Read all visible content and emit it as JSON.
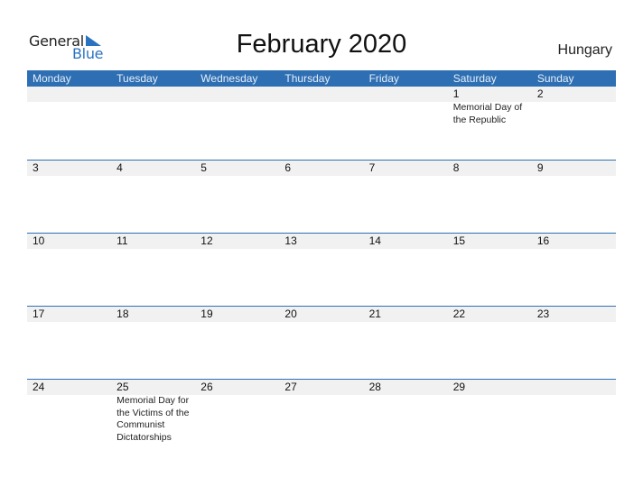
{
  "logo": {
    "general": "General",
    "blue": "Blue"
  },
  "title": "February 2020",
  "country": "Hungary",
  "colors": {
    "accent": "#2e6fb3",
    "strip": "#f1f1f1"
  },
  "weekdays": [
    "Monday",
    "Tuesday",
    "Wednesday",
    "Thursday",
    "Friday",
    "Saturday",
    "Sunday"
  ],
  "weeks": [
    [
      {
        "d": ""
      },
      {
        "d": ""
      },
      {
        "d": ""
      },
      {
        "d": ""
      },
      {
        "d": ""
      },
      {
        "d": "1",
        "event": "Memorial Day of the Republic"
      },
      {
        "d": "2"
      }
    ],
    [
      {
        "d": "3"
      },
      {
        "d": "4"
      },
      {
        "d": "5"
      },
      {
        "d": "6"
      },
      {
        "d": "7"
      },
      {
        "d": "8"
      },
      {
        "d": "9"
      }
    ],
    [
      {
        "d": "10"
      },
      {
        "d": "11"
      },
      {
        "d": "12"
      },
      {
        "d": "13"
      },
      {
        "d": "14"
      },
      {
        "d": "15"
      },
      {
        "d": "16"
      }
    ],
    [
      {
        "d": "17"
      },
      {
        "d": "18"
      },
      {
        "d": "19"
      },
      {
        "d": "20"
      },
      {
        "d": "21"
      },
      {
        "d": "22"
      },
      {
        "d": "23"
      }
    ],
    [
      {
        "d": "24"
      },
      {
        "d": "25",
        "event": "Memorial Day for the Victims of the Communist Dictatorships"
      },
      {
        "d": "26"
      },
      {
        "d": "27"
      },
      {
        "d": "28"
      },
      {
        "d": "29"
      },
      {
        "d": ""
      }
    ]
  ]
}
